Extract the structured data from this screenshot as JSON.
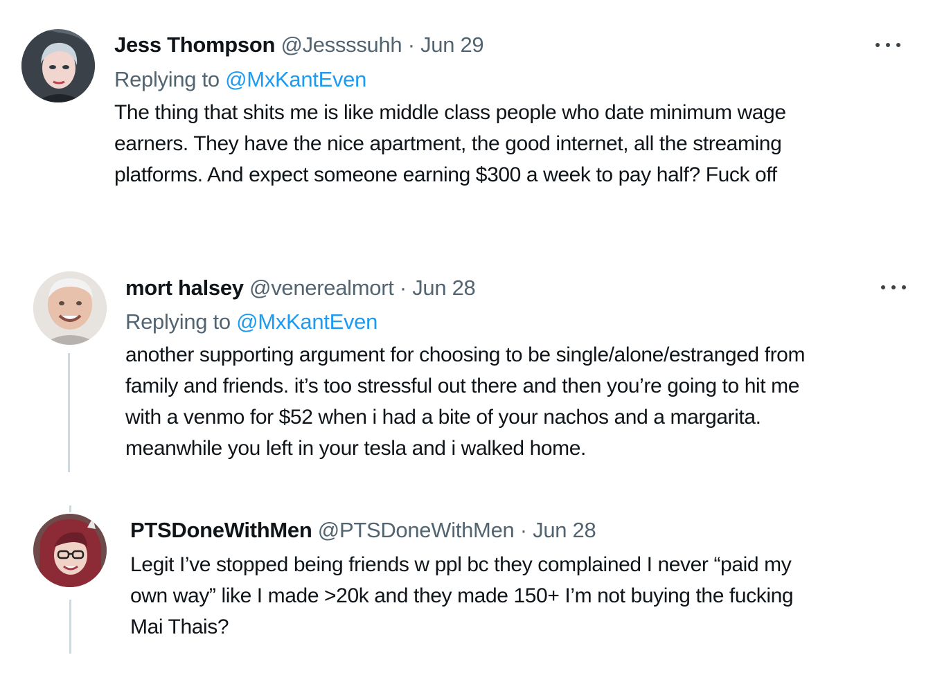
{
  "tweets": [
    {
      "name": "Jess Thompson",
      "handle": "@Jessssuhh",
      "separator": "·",
      "date": "Jun 29",
      "replying_prefix": "Replying to",
      "replying_to": "@MxKantEven",
      "lines": [
        "The thing that shits me is like middle class people who date minimum wage",
        "earners. They have the nice apartment, the good internet, all the streaming",
        "platforms. And expect someone earning $300 a week to pay half? Fuck off"
      ],
      "more_icon": "more-horizontal-icon"
    },
    {
      "name": "mort halsey",
      "handle": "@venerealmort",
      "separator": "·",
      "date": "Jun 28",
      "replying_prefix": "Replying to",
      "replying_to": "@MxKantEven",
      "lines": [
        "another supporting argument for choosing to be single/alone/estranged from",
        "family and friends. it’s too stressful out there and then you’re going to hit me",
        "with a venmo for $52 when i had a bite of your nachos and a margarita.",
        "meanwhile you left in your tesla and i walked home."
      ],
      "more_icon": "more-horizontal-icon"
    },
    {
      "name": "PTSDoneWithMen",
      "handle": "@PTSDoneWithMen",
      "separator": "·",
      "date": "Jun 28",
      "lines": [
        "Legit I’ve stopped being friends w ppl bc they complained I never “paid my",
        "own way” like I made >20k and they made 150+ I’m not buying the fucking",
        "Mai Thais?"
      ]
    }
  ],
  "colors": {
    "text": "#0f1419",
    "secondary": "#536471",
    "link": "#1d9bf0",
    "thread_line": "#cfd9de"
  }
}
